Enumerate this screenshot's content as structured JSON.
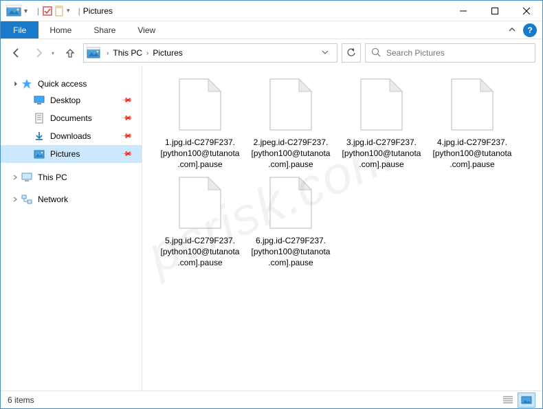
{
  "title": "Pictures",
  "ribbon": {
    "file": "File",
    "tabs": [
      "Home",
      "Share",
      "View"
    ]
  },
  "breadcrumbs": [
    "This PC",
    "Pictures"
  ],
  "search_placeholder": "Search Pictures",
  "sidebar": {
    "quick_access": "Quick access",
    "items": [
      {
        "label": "Desktop"
      },
      {
        "label": "Documents"
      },
      {
        "label": "Downloads"
      },
      {
        "label": "Pictures"
      }
    ],
    "this_pc": "This PC",
    "network": "Network"
  },
  "files": [
    "1.jpg.id-C279F237.[python100@tutanota.com].pause",
    "2.jpeg.id-C279F237.[python100@tutanota.com].pause",
    "3.jpg.id-C279F237.[python100@tutanota.com].pause",
    "4.jpg.id-C279F237.[python100@tutanota.com].pause",
    "5.jpg.id-C279F237.[python100@tutanota.com].pause",
    "6.jpg.id-C279F237.[python100@tutanota.com].pause"
  ],
  "status": "6 items",
  "watermark": "pcrisk.com"
}
